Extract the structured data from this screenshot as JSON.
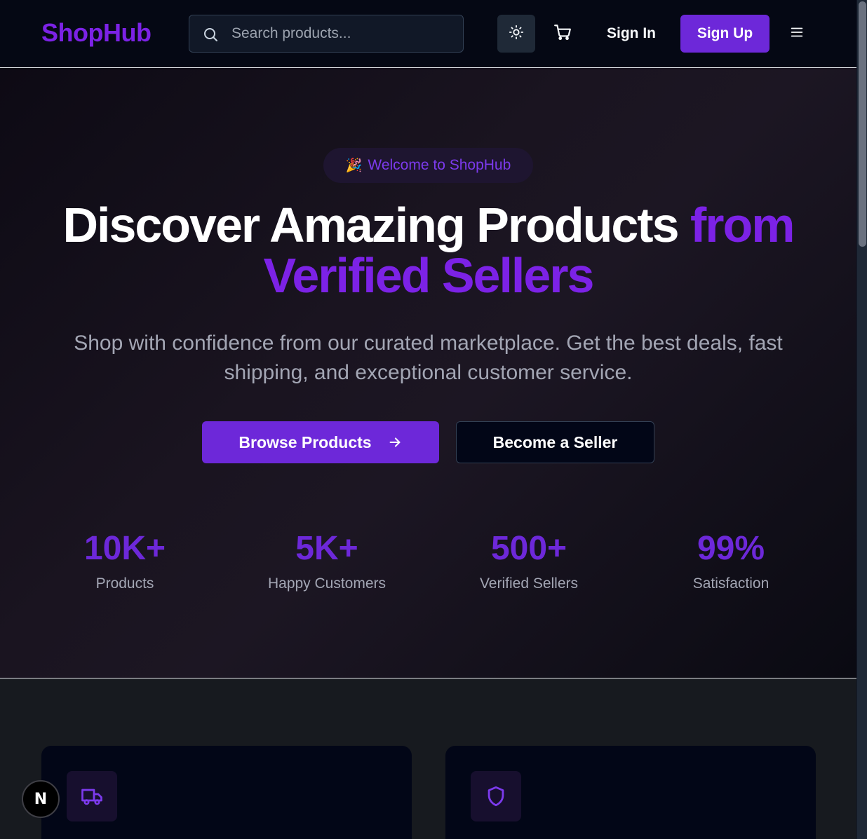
{
  "header": {
    "logo": "ShopHub",
    "search": {
      "placeholder": "Search products..."
    },
    "sign_in": "Sign In",
    "sign_up": "Sign Up"
  },
  "hero": {
    "badge": {
      "icon": "🎉",
      "text": "Welcome to ShopHub"
    },
    "headline_main": "Discover Amazing Products ",
    "headline_accent_1": "from",
    "headline_accent_2": "Verified Sellers",
    "subtext": "Shop with confidence from our curated marketplace. Get the best deals, fast shipping, and exceptional customer service.",
    "browse_button": "Browse Products",
    "seller_button": "Become a Seller",
    "stats": [
      {
        "value": "10K+",
        "label": "Products"
      },
      {
        "value": "5K+",
        "label": "Happy Customers"
      },
      {
        "value": "500+",
        "label": "Verified Sellers"
      },
      {
        "value": "99%",
        "label": "Satisfaction"
      }
    ]
  },
  "features": {
    "cards": [
      {
        "icon": "truck-icon"
      },
      {
        "icon": "shield-icon"
      }
    ]
  },
  "dev_badge": "N",
  "colors": {
    "brand": "#7c22e6",
    "button": "#6d28d9",
    "background": "#020617"
  }
}
